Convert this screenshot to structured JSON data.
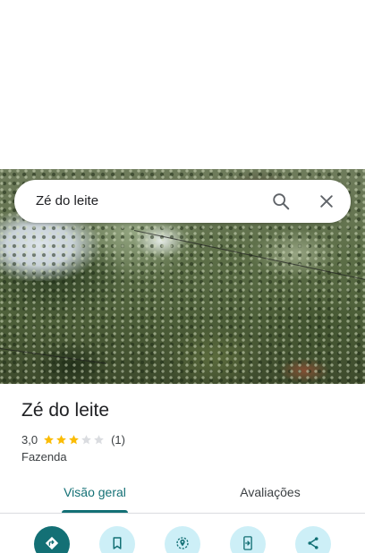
{
  "search": {
    "query": "Zé do leite"
  },
  "place": {
    "name": "Zé do leite",
    "rating": "3,0",
    "stars": 3,
    "review_count": "(1)",
    "category": "Fazenda"
  },
  "tabs": [
    {
      "label": "Visão geral",
      "selected": true
    },
    {
      "label": "Avaliações",
      "selected": false
    }
  ],
  "actions": [
    {
      "icon": "directions-icon"
    },
    {
      "icon": "bookmark-icon"
    },
    {
      "icon": "nearby-icon"
    },
    {
      "icon": "send-to-phone-icon"
    },
    {
      "icon": "share-icon"
    }
  ],
  "colors": {
    "accent": "#137075",
    "action_bg": "#cdeff7",
    "star_filled": "#fbbc04",
    "star_empty": "#dadce0"
  }
}
